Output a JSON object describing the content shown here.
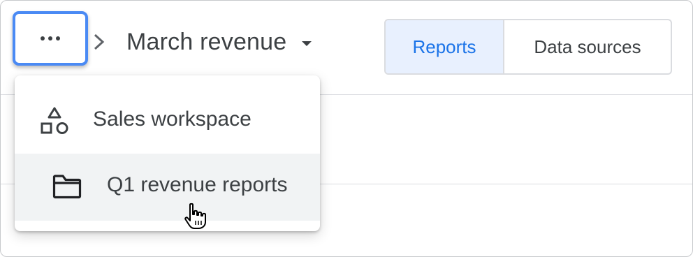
{
  "toolbar": {
    "more_button_icon": "more-horiz-icon",
    "breadcrumb_separator_icon": "chevron-right-icon",
    "report_title": "March revenue",
    "title_dropdown_icon": "arrow-drop-down-icon",
    "view_toggle": {
      "options": [
        "Reports",
        "Data sources"
      ],
      "selected": "Reports"
    }
  },
  "breadcrumb_menu": {
    "items": [
      {
        "label": "Sales workspace",
        "icon": "shapes-icon"
      },
      {
        "label": "Q1 revenue reports",
        "icon": "folder-icon",
        "hovered": true
      }
    ]
  },
  "pointer": "hand-pointer-icon",
  "colors": {
    "accent": "#1a73e8",
    "focus_ring": "#4a8af4",
    "selected_bg": "#e8f0fe",
    "hover_bg": "#f1f3f4",
    "text": "#3c4043",
    "border": "#dadce0"
  }
}
